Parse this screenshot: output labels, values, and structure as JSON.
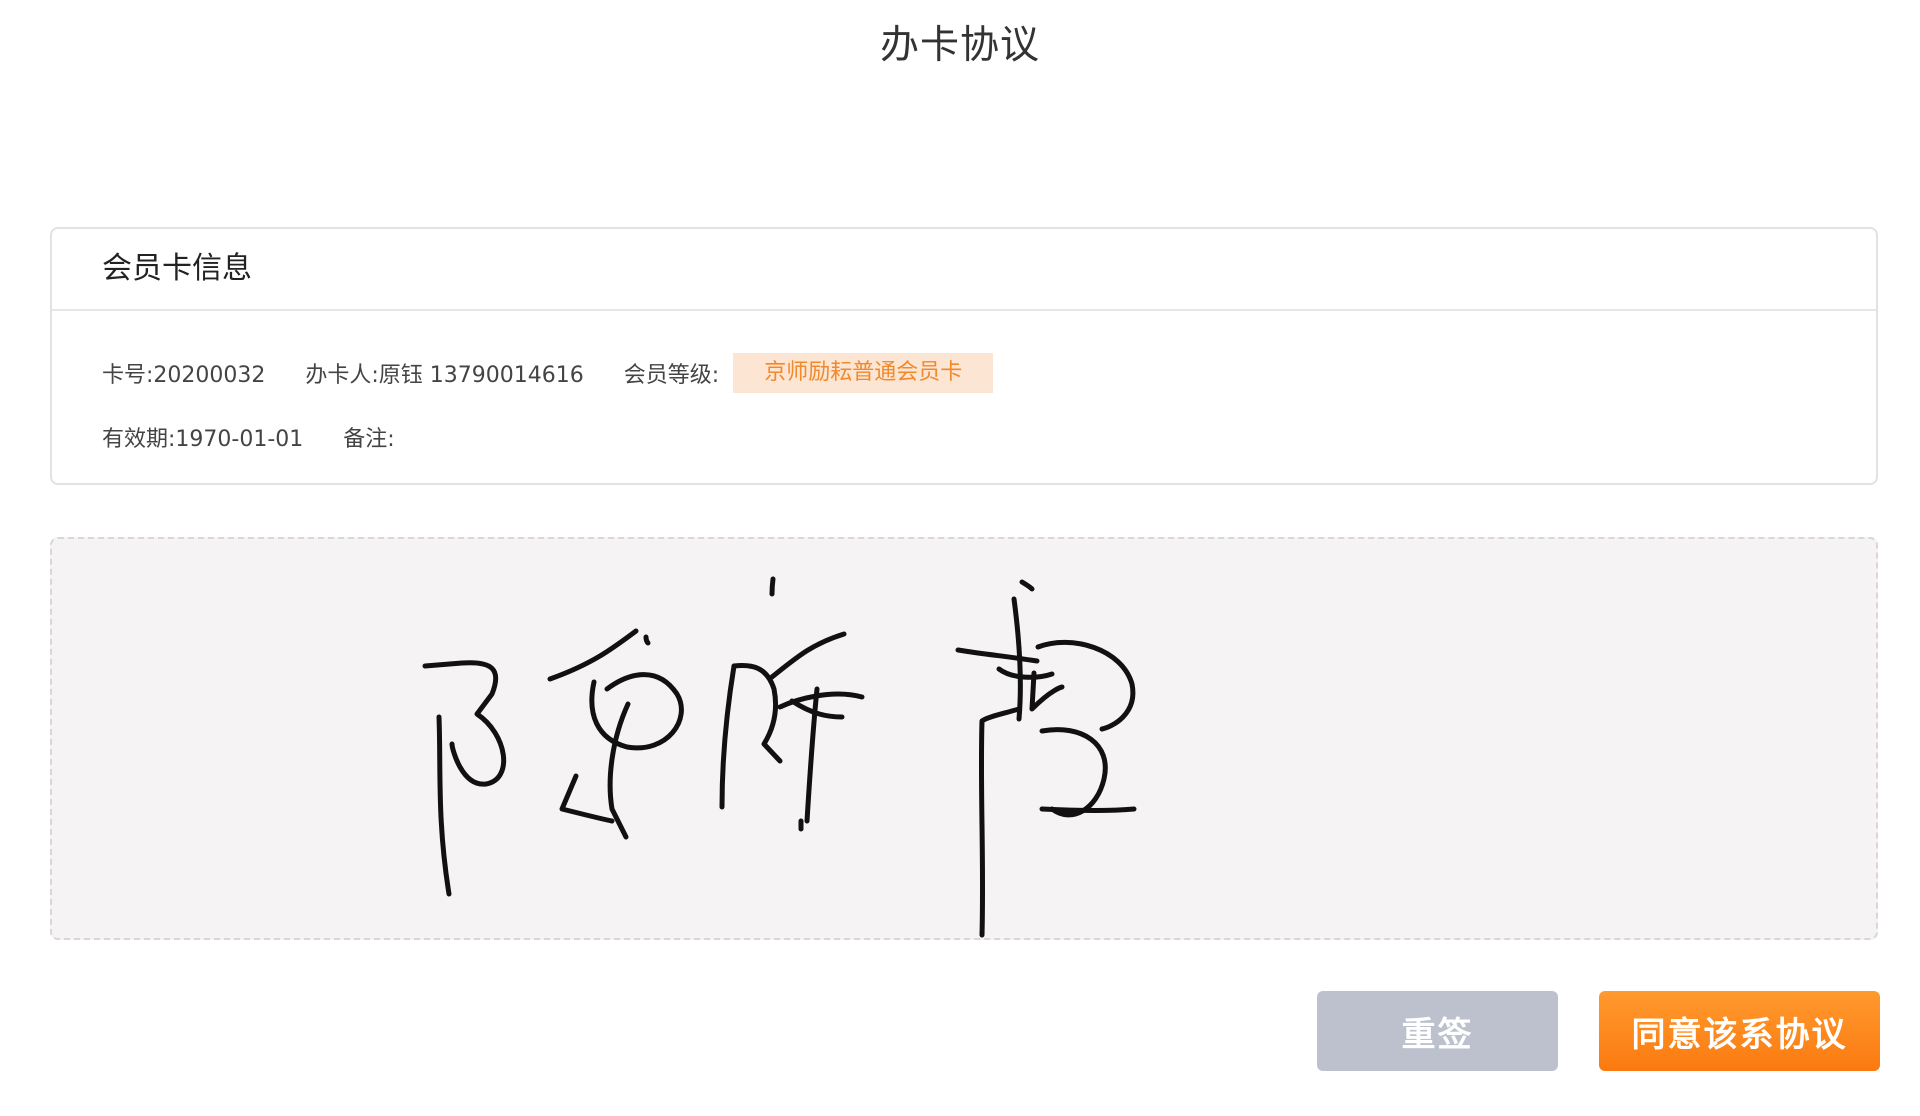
{
  "page": {
    "title": "办卡协议"
  },
  "card_info": {
    "header": "会员卡信息",
    "card_number": "卡号:20200032",
    "applicant": "办卡人:原钰 13790014616",
    "level_label": "会员等级:",
    "level_value": "京师励耘普通会员卡",
    "expiry": "有效期:1970-01-01",
    "remark": "备注:"
  },
  "signature_pad": {
    "has_signature": true
  },
  "actions": {
    "resign_label": "重签",
    "agree_label": "同意该系协议"
  },
  "colors": {
    "accent": "#fb7a10",
    "badge_bg": "#fde5d3",
    "badge_text": "#f08a2c",
    "secondary_button": "#bcc1cd",
    "pad_bg": "#f6f3f5"
  }
}
